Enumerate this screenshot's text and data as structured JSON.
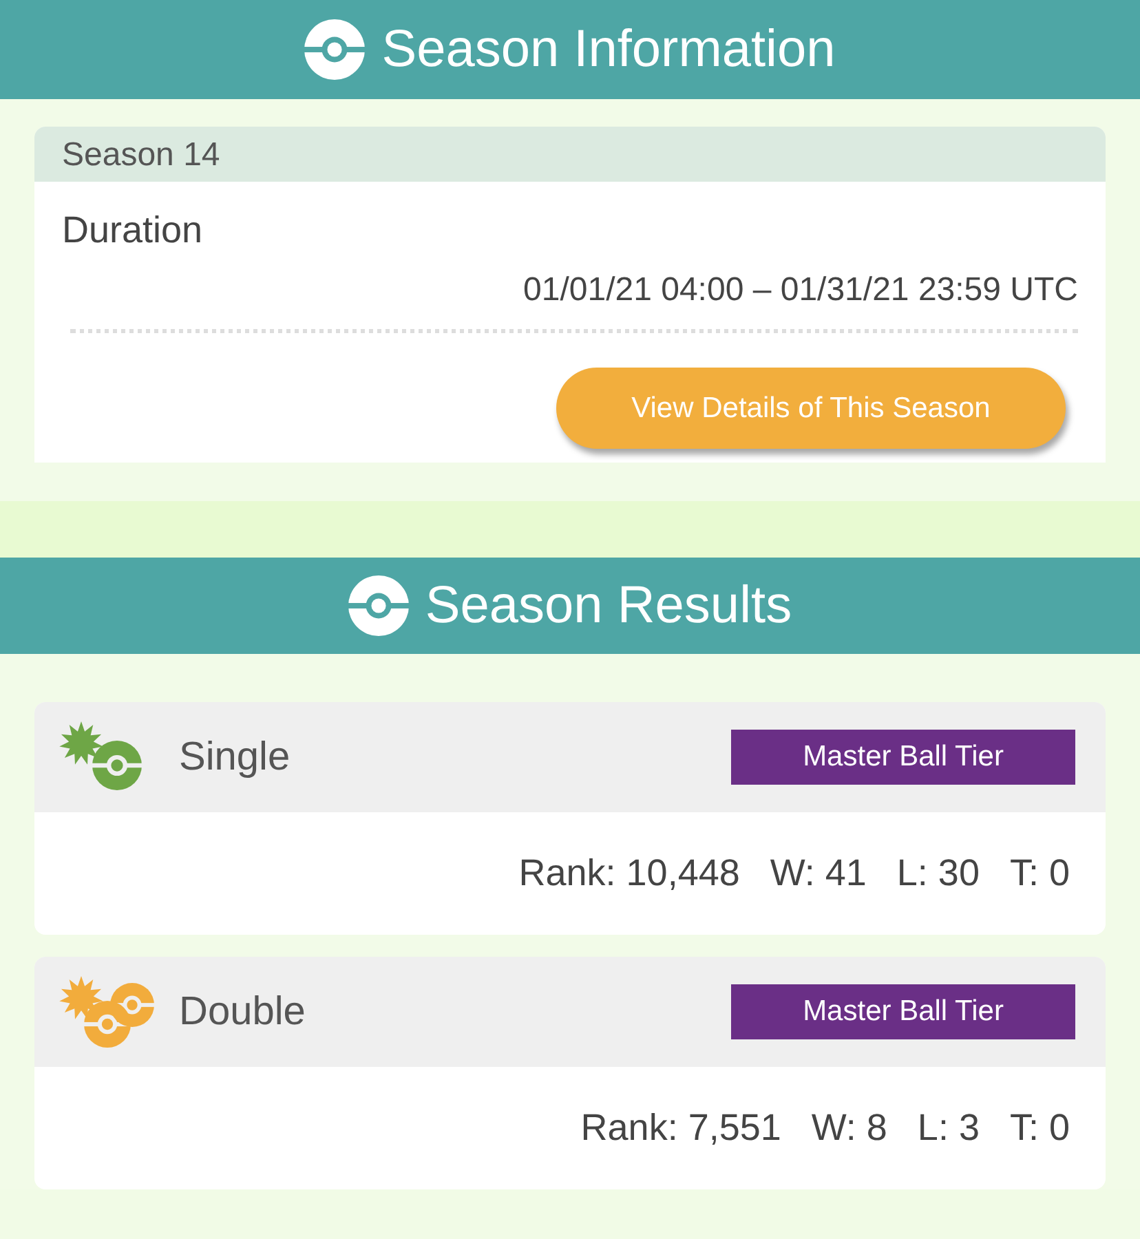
{
  "season_information": {
    "title": "Season Information",
    "season": "Season 14",
    "duration_label": "Duration",
    "duration": "01/01/21 04:00 – 01/31/21 23:59 UTC",
    "button": "View Details of This Season"
  },
  "season_results": {
    "title": "Season Results",
    "results": [
      {
        "kind": "single",
        "color": "#6ea646",
        "name": "Single",
        "tier": "Master Ball Tier",
        "rank": "Rank: 10,448",
        "wins": "W: 41",
        "losses": "L: 30",
        "ties": "T: 0"
      },
      {
        "kind": "double",
        "color": "#f2ac3c",
        "name": "Double",
        "tier": "Master Ball Tier",
        "rank": "Rank: 7,551",
        "wins": "W: 8",
        "losses": "L: 3",
        "ties": "T: 0"
      }
    ]
  }
}
